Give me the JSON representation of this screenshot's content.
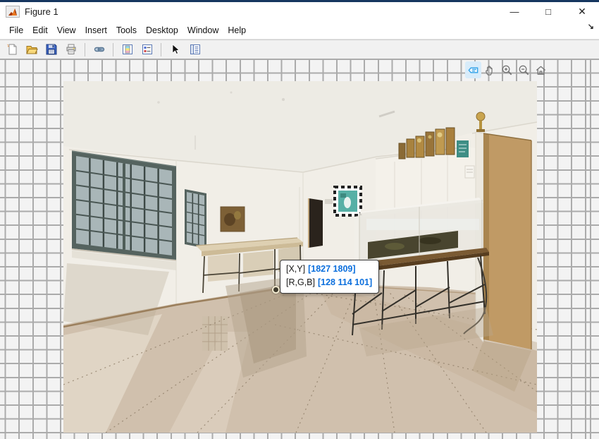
{
  "window": {
    "title": "Figure 1",
    "controls": {
      "minimize": "—",
      "maximize": "□",
      "close": "✕"
    }
  },
  "menu": {
    "items": [
      "File",
      "Edit",
      "View",
      "Insert",
      "Tools",
      "Desktop",
      "Window",
      "Help"
    ],
    "dock_arrow": "↘"
  },
  "toolbar": {
    "icons": [
      "new-figure",
      "open-file",
      "save-figure",
      "print-figure",
      "link-plot",
      "insert-colorbar",
      "insert-legend",
      "edit-plot",
      "property-editor"
    ]
  },
  "axes_toolbar": {
    "icons": [
      "datatip",
      "pan",
      "zoom-in",
      "zoom-out",
      "restore-view"
    ],
    "active_icon": "datatip"
  },
  "datatip": {
    "xy_label": "[X,Y]",
    "xy_value": "[1827 1809]",
    "rgb_label": "[R,G,B]",
    "rgb_value": "[128 114 101]",
    "value_color": "#0b6fdd"
  },
  "colors": {
    "titlebar_accent": "#16365f",
    "grid_line": "#ababab",
    "grid_bg": "#f3f3f3",
    "datatip_active_bg": "#d8ecfa",
    "datatip_icon": "#2da0e8"
  }
}
